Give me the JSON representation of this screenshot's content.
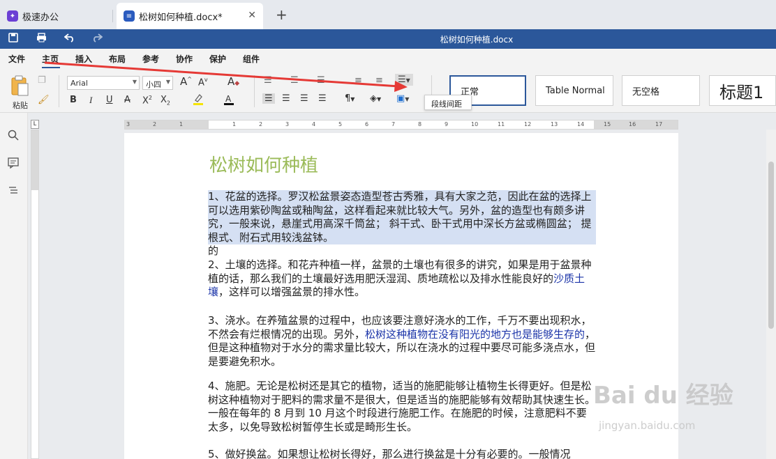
{
  "tabs": [
    {
      "label": "极速办公",
      "icon": "app-logo-icon"
    },
    {
      "label": "松树如何种植.docx*",
      "icon": "document-icon"
    }
  ],
  "titlebar": {
    "title": "松树如何种植.docx"
  },
  "menu": [
    "文件",
    "主页",
    "插入",
    "布局",
    "参考",
    "协作",
    "保护",
    "组件"
  ],
  "ribbon": {
    "paste_label": "粘贴",
    "font_name": "Arial",
    "font_size": "小四",
    "styles": [
      "正常",
      "Table Normal",
      "无空格",
      "标题1"
    ],
    "tooltip": "段线间距"
  },
  "ruler": {
    "labels": [
      "3",
      "2",
      "1",
      "1",
      "2",
      "3",
      "4",
      "5",
      "6",
      "7",
      "8",
      "9",
      "10",
      "11",
      "12",
      "13",
      "14",
      "15",
      "16",
      "17"
    ]
  },
  "document": {
    "title": "松树如何种植",
    "p1": "1、花盆的选择。罗汉松盆景姿态造型苍古秀雅，具有大家之范，因此在盆的选择上可以选用紫砂陶盆或釉陶盆，这样看起来就比较大气。另外，盆的造型也有颇多讲究，一般来说，悬崖式用高深千筒盆；  斜干式、卧干式用中深长方盆或椭圆盆；   提根式、附石式用较浅盆钵。",
    "p1b": "的",
    "p2a": "2、土壤的选择。和花卉种植一样，盆景的土壤也有很多的讲究，如果是用于盆景种植的话，那么我们的土壤最好选用肥沃湿润、质地疏松以及排水性能良好的",
    "p2link": "沙质土壤",
    "p2b": "，这样可以增强盆景的排水性。",
    "p3a": "3、浇水。在养殖盆景的过程中，也应该要注意好浇水的工作，千万不要出现积水，不然会有烂根情况的出现。另外，",
    "p3link": "松树这种植物在没有阳光的地方也是能够生存的",
    "p3b": "，但是这种植物对于水分的需求量比较大，所以在浇水的过程中要尽可能多浇点水，但是要避免积水。",
    "p4": "4、施肥。无论是松树还是其它的植物，适当的施肥能够让植物生长得更好。但是松树这种植物对于肥料的需求量不是很大，但是适当的施肥能够有效帮助其快速生长。一般在每年的 8 月到 10 月这个时段进行施肥工作。在施肥的时候，注意肥料不要太多，以免导致松树暂停生长或是畸形生长。",
    "p5": "5、做好换盆。如果想让松树长得好，那么进行换盆是十分有必要的。一般情况"
  },
  "watermark": {
    "brand": "Bai du 经验",
    "url": "jingyan.baidu.com"
  },
  "colors": {
    "accent": "#2b579a",
    "title_green": "#9bbb59",
    "selection": "#d5e0f3",
    "link_blue": "#1a33a8",
    "arrow_red": "#e53935"
  }
}
